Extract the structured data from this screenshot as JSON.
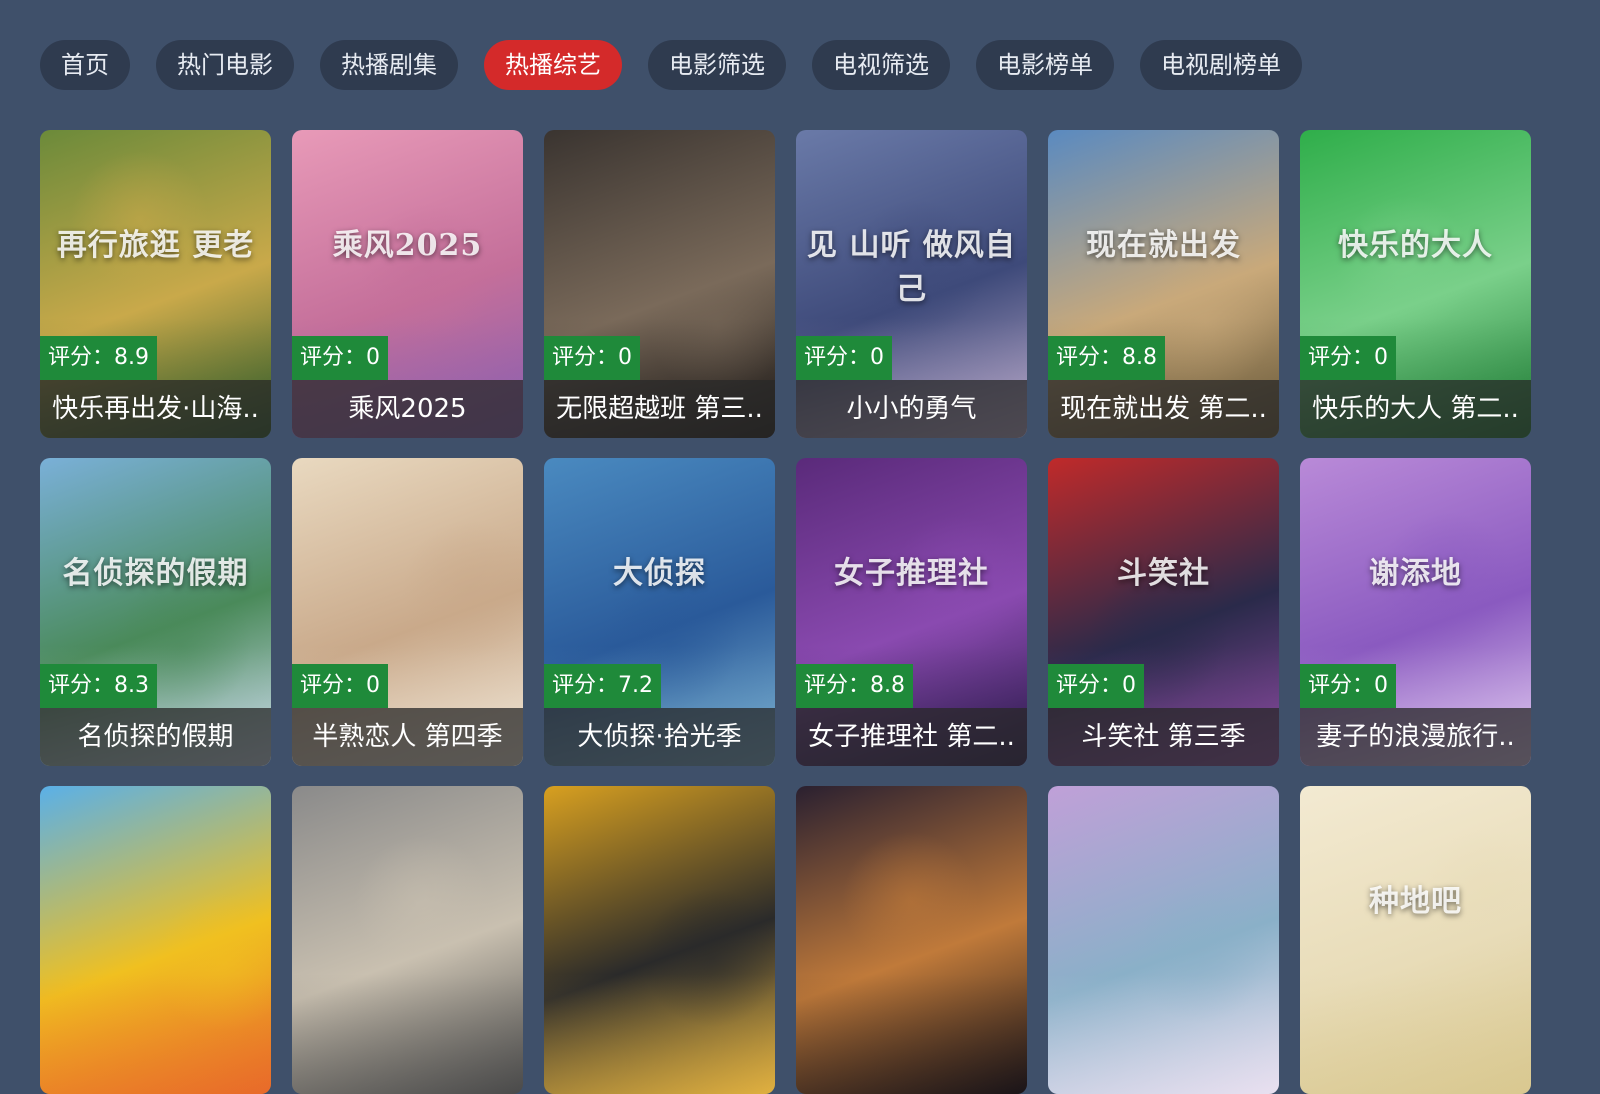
{
  "tabs": [
    {
      "label": "首页",
      "active": false
    },
    {
      "label": "热门电影",
      "active": false
    },
    {
      "label": "热播剧集",
      "active": false
    },
    {
      "label": "热播综艺",
      "active": true
    },
    {
      "label": "电影筛选",
      "active": false
    },
    {
      "label": "电视筛选",
      "active": false
    },
    {
      "label": "电影榜单",
      "active": false
    },
    {
      "label": "电视剧榜单",
      "active": false
    }
  ],
  "colors": {
    "background": "#3f506a",
    "tab_bg": "#2f3b4f",
    "tab_active": "#d42a2a",
    "rating_bg": "#1f8a3a"
  },
  "cards": [
    {
      "title": "快乐再出发·山海..",
      "rating": "评分：8.9",
      "poster_text": "再行旅逛 更老",
      "palette": [
        "#6b8a3a",
        "#c9a94a",
        "#2e5a2a"
      ]
    },
    {
      "title": "乘风2025",
      "rating": "评分：0",
      "poster_text": "乘风2025",
      "palette": [
        "#e89ab8",
        "#c46f9a",
        "#8a5fb0"
      ]
    },
    {
      "title": "无限超越班 第三..",
      "rating": "评分：0",
      "poster_text": "",
      "palette": [
        "#3a3430",
        "#7a6a5a",
        "#1e1a18"
      ]
    },
    {
      "title": "小小的勇气",
      "rating": "评分：0",
      "poster_text": "见 山听 做风自己",
      "palette": [
        "#6a7aa8",
        "#3e4a7a",
        "#b9a9c9"
      ]
    },
    {
      "title": "现在就出发 第二..",
      "rating": "评分：8.8",
      "poster_text": "现在就出发",
      "palette": [
        "#5a8ac0",
        "#c9a97a",
        "#6a5a3a"
      ]
    },
    {
      "title": "快乐的大人 第二..",
      "rating": "评分：0",
      "poster_text": "快乐的大人",
      "palette": [
        "#2fae4a",
        "#7ad08a",
        "#1e7a34"
      ]
    },
    {
      "title": "名侦探的假期",
      "rating": "评分：8.3",
      "poster_text": "名侦探的假期",
      "palette": [
        "#7ab0d8",
        "#4a8a5a",
        "#c9d9e9"
      ]
    },
    {
      "title": "半熟恋人 第四季",
      "rating": "评分：0",
      "poster_text": "",
      "palette": [
        "#e9d9c0",
        "#c9a98a",
        "#f0e6d6"
      ]
    },
    {
      "title": "大侦探·拾光季",
      "rating": "评分：7.2",
      "poster_text": "大侦探",
      "palette": [
        "#4a8ac0",
        "#2a5a9a",
        "#7ab0d0"
      ]
    },
    {
      "title": "女子推理社 第二..",
      "rating": "评分：8.8",
      "poster_text": "女子推理社",
      "palette": [
        "#5a2a7a",
        "#8a4ab0",
        "#2a1a4a"
      ]
    },
    {
      "title": "斗笑社 第三季",
      "rating": "评分：0",
      "poster_text": "斗笑社",
      "palette": [
        "#c02a2a",
        "#2a2a4a",
        "#8a4aa0"
      ]
    },
    {
      "title": "妻子的浪漫旅行..",
      "rating": "评分：0",
      "poster_text": "谢添地",
      "palette": [
        "#b98ad8",
        "#8a5ac0",
        "#e0c9f0"
      ]
    },
    {
      "title": "",
      "rating": "",
      "poster_text": "",
      "palette": [
        "#5ab0e8",
        "#f0c020",
        "#e86a2a"
      ]
    },
    {
      "title": "",
      "rating": "",
      "poster_text": "",
      "palette": [
        "#8a8a8a",
        "#c9c0b0",
        "#4a4a4a"
      ]
    },
    {
      "title": "",
      "rating": "",
      "poster_text": "",
      "palette": [
        "#d8a020",
        "#2a2a2a",
        "#e0b040"
      ]
    },
    {
      "title": "",
      "rating": "",
      "poster_text": "",
      "palette": [
        "#2a2030",
        "#c07a3a",
        "#1a1418"
      ]
    },
    {
      "title": "",
      "rating": "",
      "poster_text": "",
      "palette": [
        "#c0a0d8",
        "#8ab0c8",
        "#e9e0f0"
      ]
    },
    {
      "title": "",
      "rating": "",
      "poster_text": "种地吧",
      "palette": [
        "#f3ead2",
        "#e8dcb8",
        "#d9c890"
      ]
    }
  ]
}
